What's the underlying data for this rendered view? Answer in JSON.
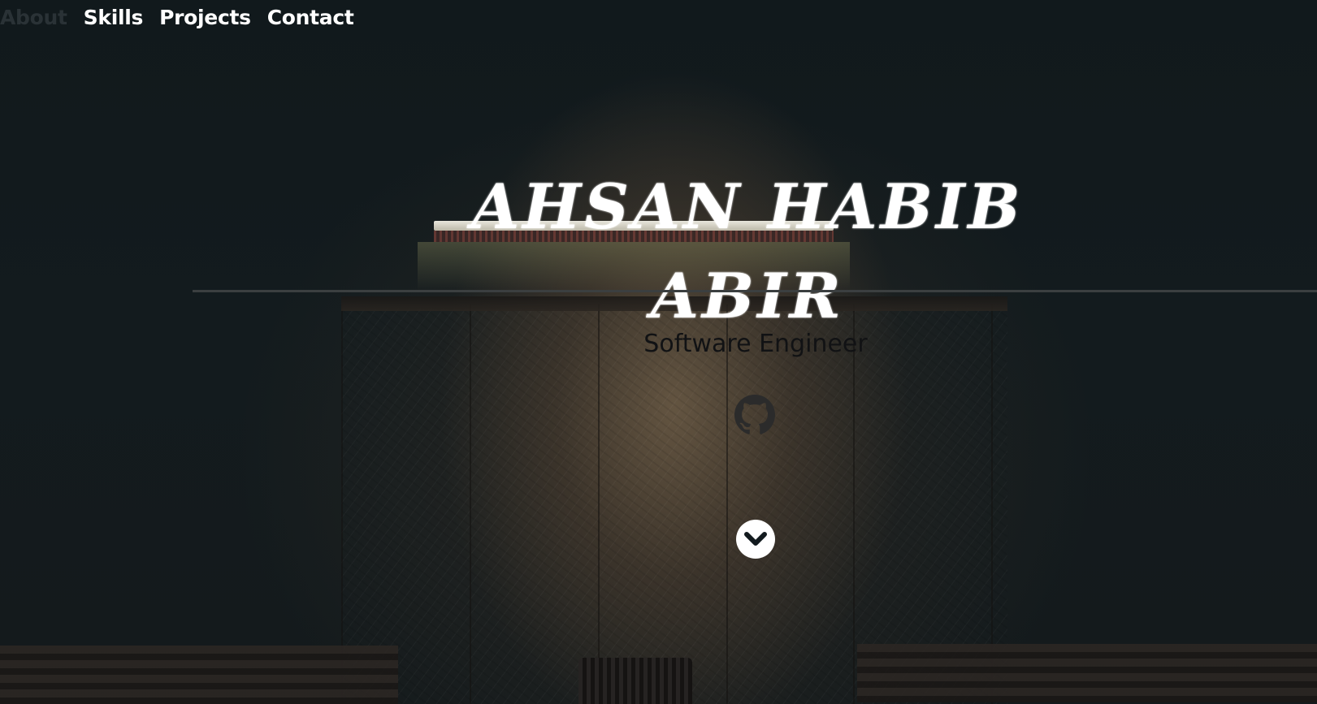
{
  "nav": {
    "items": [
      {
        "label": "About",
        "active": true
      },
      {
        "label": "Skills",
        "active": false
      },
      {
        "label": "Projects",
        "active": false
      },
      {
        "label": "Contact",
        "active": false
      }
    ]
  },
  "hero": {
    "name": "Ahsan Habib Abir",
    "role": "Software Engineer",
    "social_icon": "github-icon",
    "scroll_icon": "chevron-down-icon"
  },
  "colors": {
    "nav_text": "#ffffff",
    "nav_active": "#2a3236",
    "name_text": "#ffffff",
    "role_text": "#111214",
    "background": "#121a1e"
  }
}
